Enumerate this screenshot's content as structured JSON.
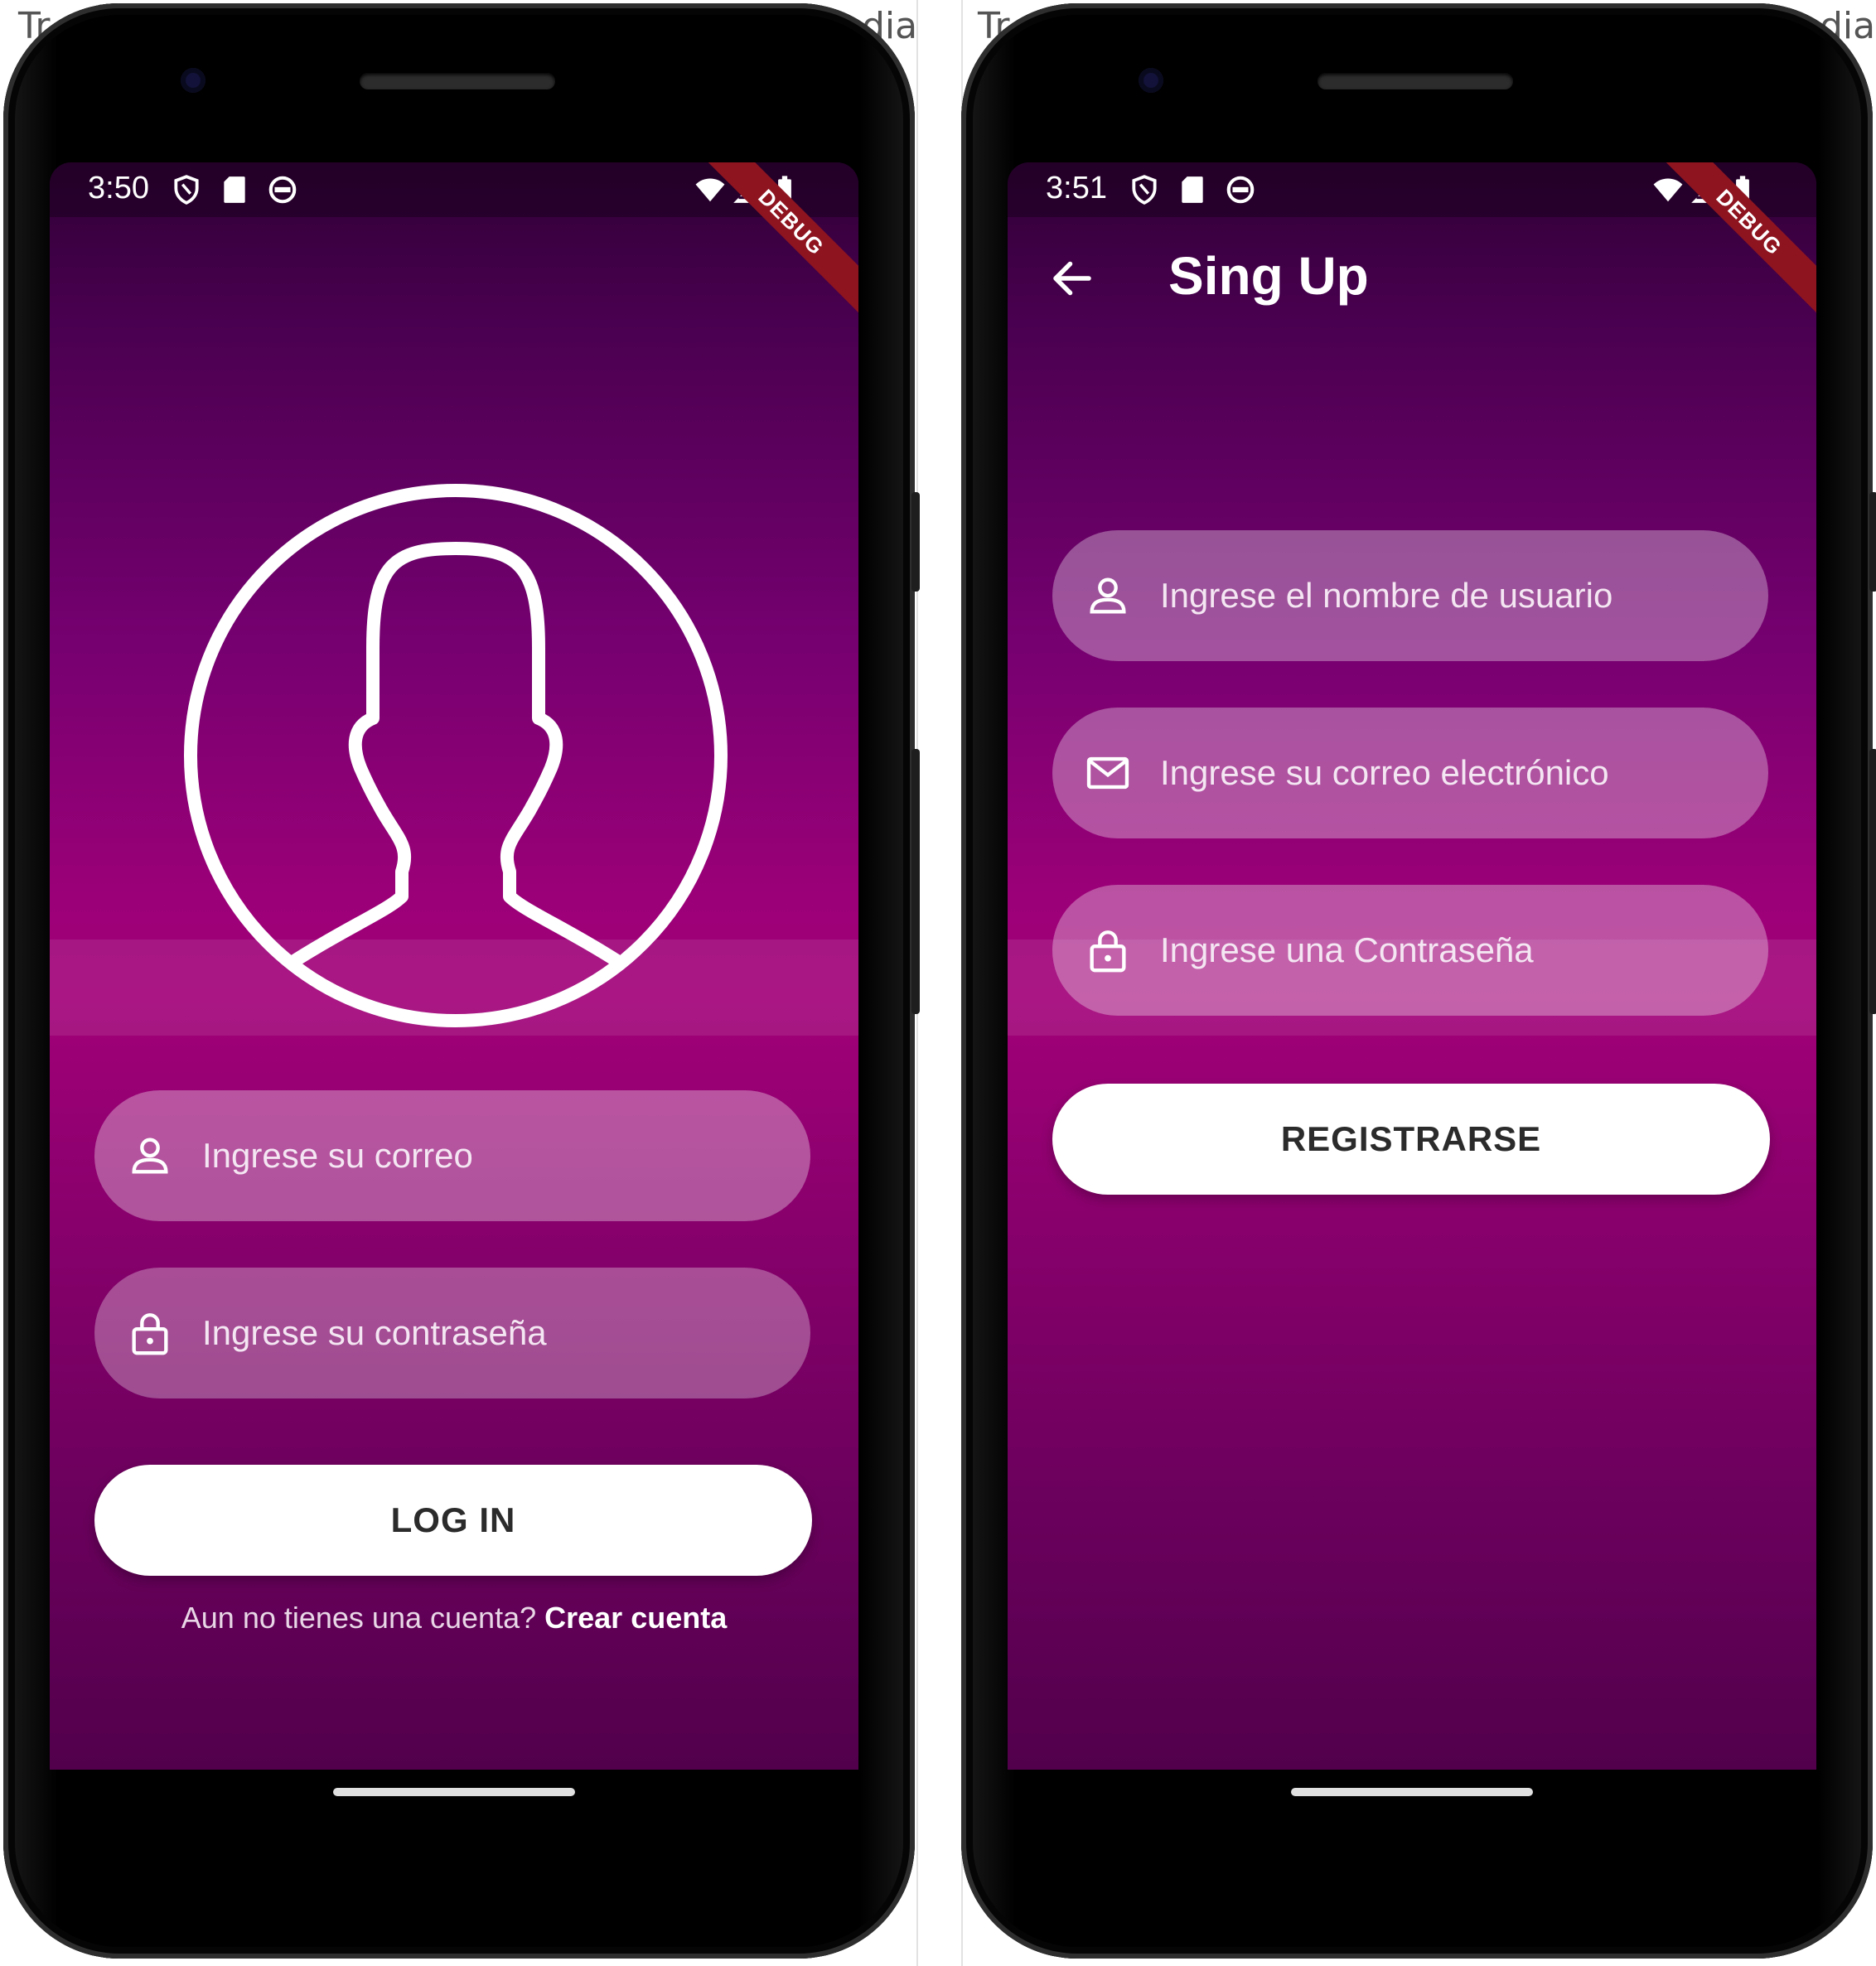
{
  "background": {
    "left_text": "Tr",
    "left_text_right": "dia",
    "right_text": "Tr",
    "right_text_right": "dia"
  },
  "colors": {
    "gradient_top": "#2f0035",
    "gradient_mid": "#a20078",
    "gradient_bottom": "#52004c",
    "debug_banner": "#8e1420",
    "button_bg": "#ffffff",
    "field_bg": "rgba(255,255,255,0.32)"
  },
  "login_screen": {
    "status_bar": {
      "time": "3:50",
      "left_icons": [
        "shield-icon",
        "sd-card-icon",
        "sync-icon"
      ],
      "right_icons": [
        "wifi-icon",
        "signal-icon",
        "battery-icon"
      ]
    },
    "debug_banner": "DEBUG",
    "avatar_icon": "account-circle-icon",
    "email_field": {
      "icon": "person-icon",
      "placeholder": "Ingrese su correo"
    },
    "password_field": {
      "icon": "lock-icon",
      "placeholder": "Ingrese su contraseña"
    },
    "login_button": "LOG IN",
    "signup_prompt": "Aun no tienes una cuenta?",
    "signup_link": "Crear cuenta"
  },
  "signup_screen": {
    "status_bar": {
      "time": "3:51",
      "left_icons": [
        "shield-icon",
        "sd-card-icon",
        "sync-icon"
      ],
      "right_icons": [
        "wifi-icon",
        "signal-icon",
        "battery-icon"
      ]
    },
    "debug_banner": "DEBUG",
    "back_icon": "arrow-back-icon",
    "title": "Sing Up",
    "username_field": {
      "icon": "person-icon",
      "placeholder": "Ingrese el nombre de usuario"
    },
    "email_field": {
      "icon": "mail-icon",
      "placeholder": "Ingrese su correo electrónico"
    },
    "password_field": {
      "icon": "lock-icon",
      "placeholder": "Ingrese una Contraseña"
    },
    "register_button": "REGISTRARSE"
  }
}
